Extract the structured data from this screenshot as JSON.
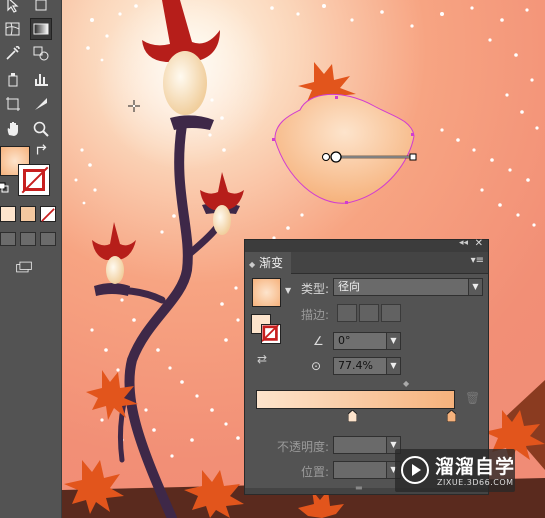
{
  "panel": {
    "tab_label": "渐变",
    "type_label": "类型:",
    "type_value": "径向",
    "stroke_label": "描边:",
    "angle_value": "0°",
    "aspect_value": "77.4%",
    "opacity_label": "不透明度:",
    "position_label": "位置:"
  },
  "gradient": {
    "start_color": "#fde4cc",
    "end_color": "#f6b27c"
  },
  "watermark": {
    "title": "溜溜自学",
    "url": "ZIXUE.3D66.COM"
  },
  "colors": {
    "ui_panel": "#535353",
    "stroke_red": "#c71f1f",
    "artwork_bg": "#f28f76",
    "selection": "#d13cd1"
  },
  "icons": {
    "panel_collapse": "double-chevron-icon",
    "panel_close": "close-icon",
    "panel_menu": "menu-icon",
    "delete_stop": "trash-icon"
  }
}
